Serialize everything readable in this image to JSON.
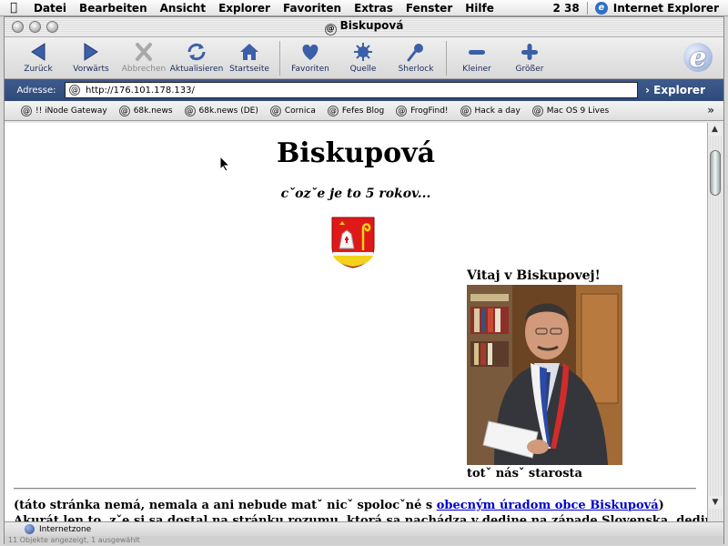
{
  "menubar": {
    "items": [
      "Datei",
      "Bearbeiten",
      "Ansicht",
      "Explorer",
      "Favoriten",
      "Extras",
      "Fenster",
      "Hilfe"
    ],
    "clock": "2 38",
    "app_name": "Internet Explorer"
  },
  "window": {
    "title": "Biskupová"
  },
  "toolbar": {
    "back": "Zurück",
    "forward": "Vorwärts",
    "stop": "Abbrechen",
    "refresh": "Aktualisieren",
    "home": "Startseite",
    "favorites": "Favoriten",
    "source": "Quelle",
    "sherlock": "Sherlock",
    "smaller": "Kleiner",
    "larger": "Größer"
  },
  "address": {
    "label": "Adresse:",
    "url": "http://176.101.178.133/",
    "go_label": "Explorer"
  },
  "favorites": [
    "!! iNode Gateway",
    "68k.news",
    "68k.news (DE)",
    "Cornica",
    "Fefes Blog",
    "FrogFind!",
    "Hack a day",
    "Mac OS 9 Lives"
  ],
  "page": {
    "title": "Biskupová",
    "subtitle": "cˇozˇe je to 5 rokov...",
    "welcome": "Vitaj v Biskupovej!",
    "caption": "totˇ násˇ starosta",
    "para_before": "(táto stránka nemá, nemala a ani nebude matˇ nicˇ spolocˇné s ",
    "para_link": "obecným úradom obce Biskupová",
    "para_after": ")",
    "para2": "Akurát len to, zˇe si sa dostal na stránku rozumu, ktorá sa nachádza v dedine na západe Slovenska, dedine"
  },
  "status": {
    "zone": "Internetzone",
    "footer": "11 Objekte angezeigt, 1 ausgewählt"
  },
  "colors": {
    "link": "#0000cc",
    "address_bar": "#2e4a7a"
  }
}
